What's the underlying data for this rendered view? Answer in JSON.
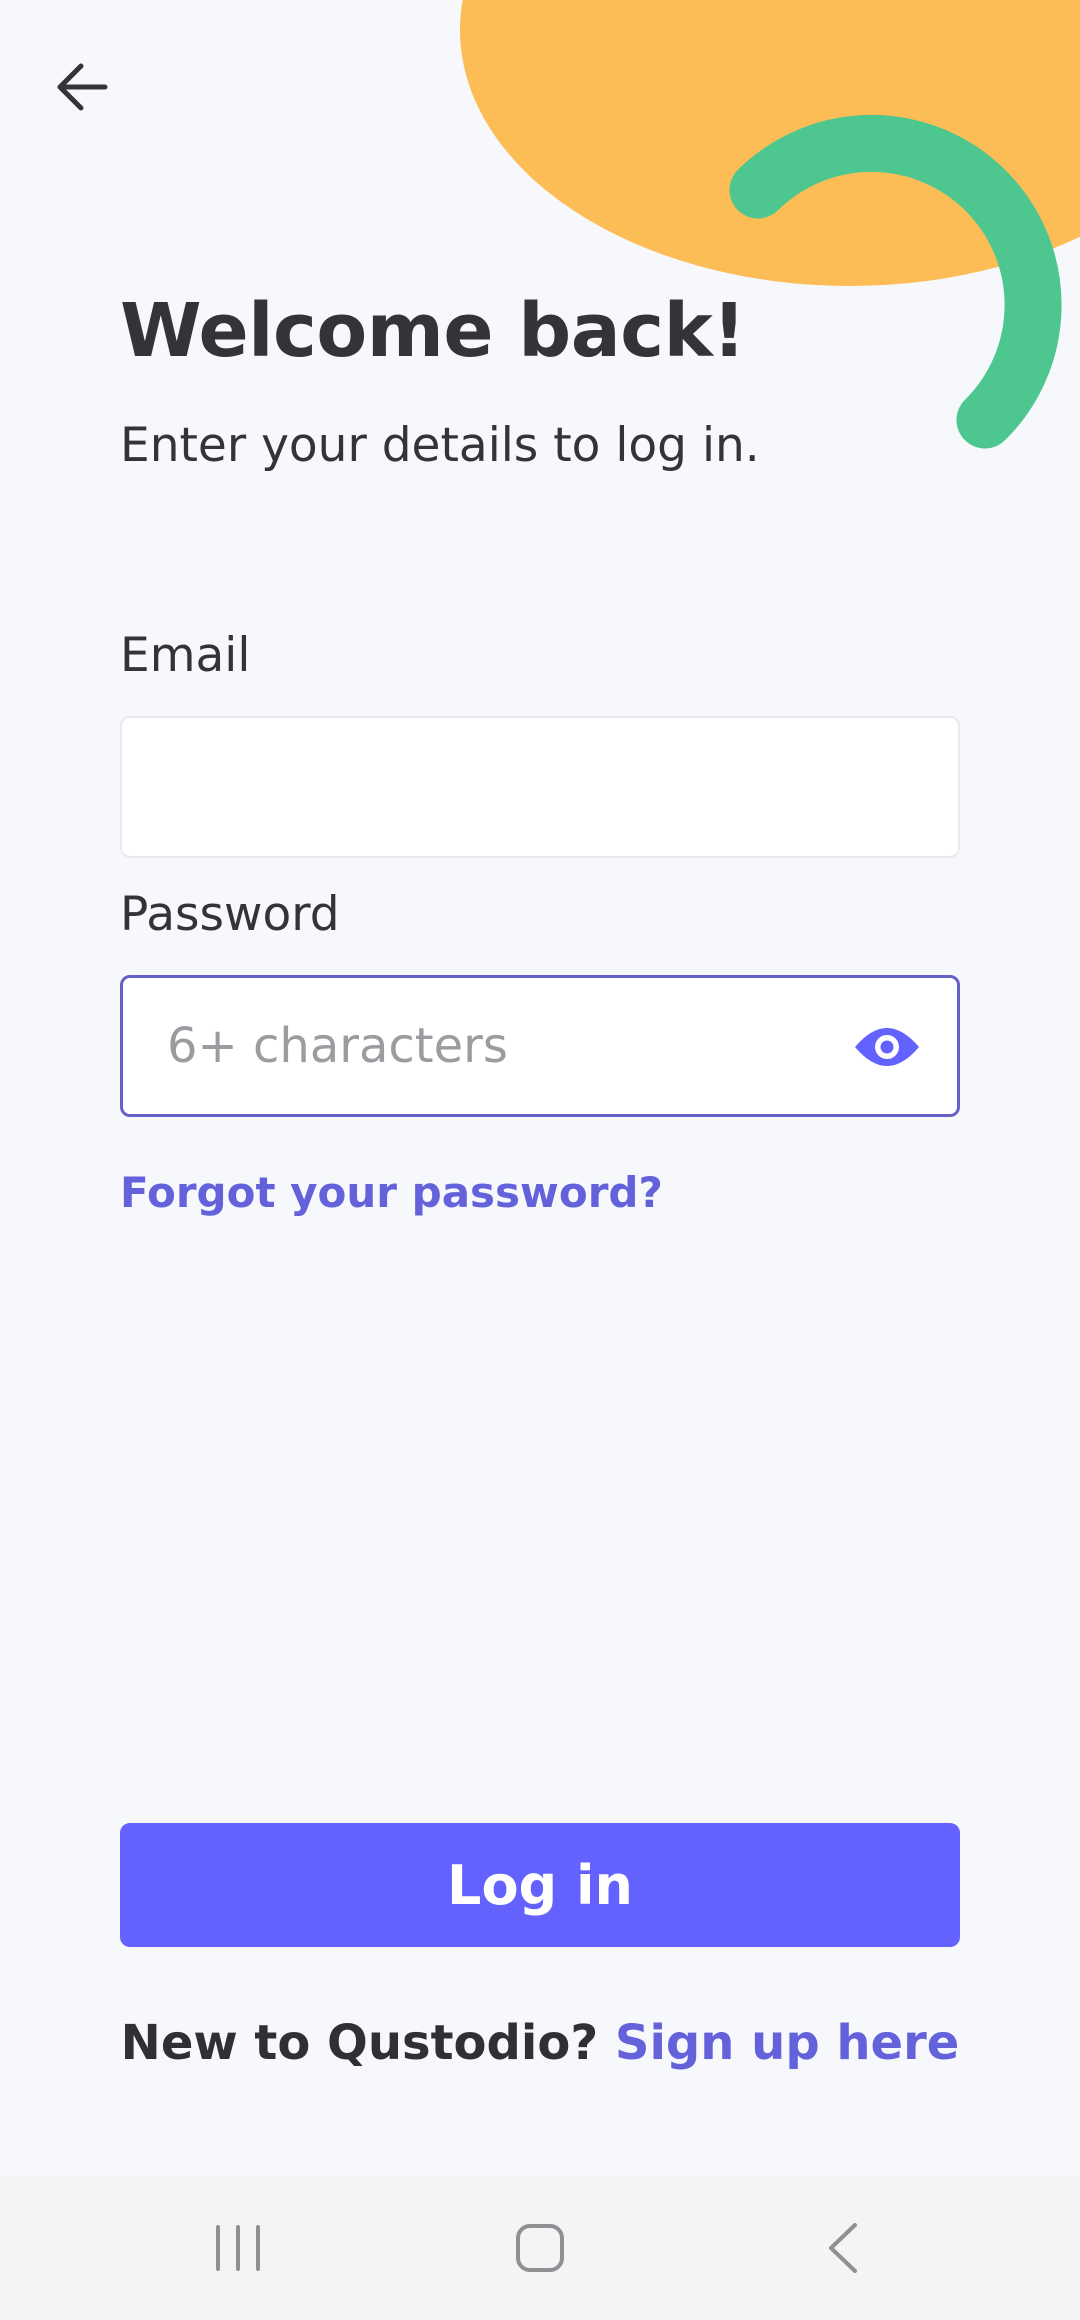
{
  "header": {
    "title": "Welcome back!",
    "subtitle": "Enter your details to log in."
  },
  "form": {
    "email": {
      "label": "Email",
      "value": "",
      "placeholder": ""
    },
    "password": {
      "label": "Password",
      "value": "",
      "placeholder": "6+ characters"
    },
    "forgot_link": "Forgot your password?"
  },
  "actions": {
    "login_label": "Log in",
    "signup_prompt": "New to Qustodio?",
    "signup_link": "Sign up here"
  },
  "icons": {
    "back": "arrow-left-icon",
    "password_toggle": "eye-icon",
    "nav_recents": "recents-icon",
    "nav_home": "home-icon",
    "nav_back": "chevron-left-icon"
  },
  "colors": {
    "background": "#f7f8fc",
    "primary": "#6462ff",
    "link": "#6462db",
    "decor_orange": "#fcbd57",
    "decor_green": "#4dc78f",
    "text": "#333438"
  }
}
